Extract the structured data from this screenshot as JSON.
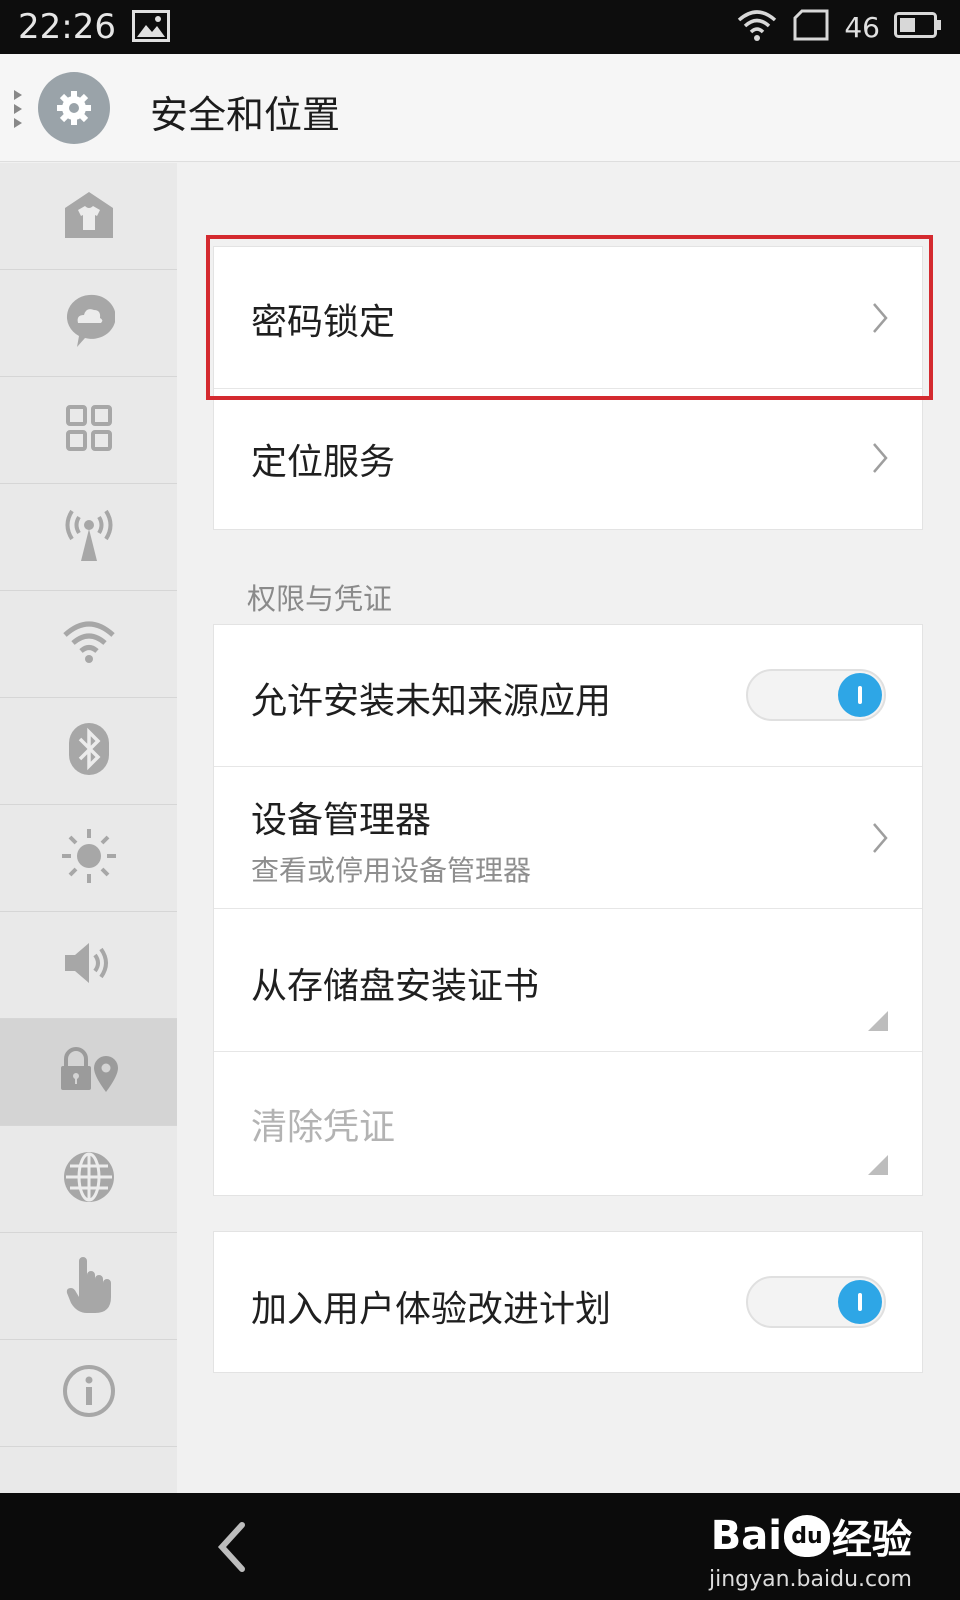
{
  "status_bar": {
    "time": "22:26",
    "signal_label": "46"
  },
  "header": {
    "title": "安全和位置",
    "icon": "gear-icon"
  },
  "sidebar": {
    "items": [
      {
        "icon": "theme-icon"
      },
      {
        "icon": "cloud-chat-icon"
      },
      {
        "icon": "apps-grid-icon"
      },
      {
        "icon": "antenna-icon"
      },
      {
        "icon": "wifi-icon"
      },
      {
        "icon": "bluetooth-icon"
      },
      {
        "icon": "brightness-icon"
      },
      {
        "icon": "volume-icon"
      },
      {
        "icon": "lock-location-icon",
        "active": true
      },
      {
        "icon": "globe-icon"
      },
      {
        "icon": "hand-icon"
      },
      {
        "icon": "info-icon"
      }
    ]
  },
  "main": {
    "group1": {
      "password_lock": "密码锁定",
      "location_service": "定位服务"
    },
    "section_header": "权限与凭证",
    "group2": {
      "unknown_sources": {
        "label": "允许安装未知来源应用",
        "enabled": true
      },
      "device_admin": {
        "label": "设备管理器",
        "subtitle": "查看或停用设备管理器"
      },
      "install_cert": "从存储盘安装证书",
      "clear_credentials": "清除凭证"
    },
    "group3": {
      "ux_program": {
        "label": "加入用户体验改进计划",
        "enabled": true
      }
    }
  },
  "highlight_color": "#d42a2f",
  "accent_color": "#2ea6e6",
  "watermark": {
    "logo_left": "Bai",
    "logo_paw": "du",
    "logo_right": "经验",
    "url": "jingyan.baidu.com"
  }
}
